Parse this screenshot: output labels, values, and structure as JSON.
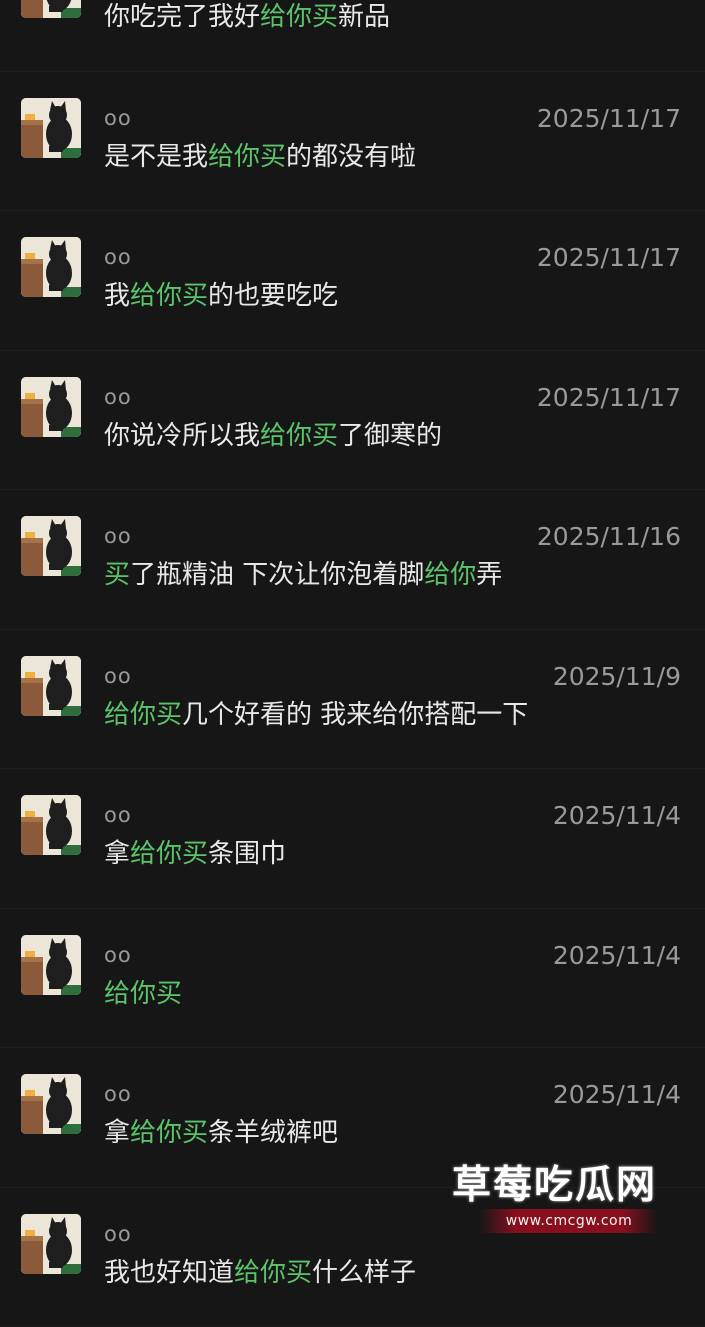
{
  "messages": [
    {
      "name": "",
      "date": "",
      "parts": [
        {
          "t": "你吃完了我好",
          "h": false
        },
        {
          "t": "给你买",
          "h": true
        },
        {
          "t": "新品",
          "h": false
        }
      ]
    },
    {
      "name": "oo",
      "date": "2025/11/17",
      "parts": [
        {
          "t": "是不是我",
          "h": false
        },
        {
          "t": "给你买",
          "h": true
        },
        {
          "t": "的都没有啦",
          "h": false
        }
      ]
    },
    {
      "name": "oo",
      "date": "2025/11/17",
      "parts": [
        {
          "t": "我",
          "h": false
        },
        {
          "t": "给你买",
          "h": true
        },
        {
          "t": "的也要吃吃",
          "h": false
        }
      ]
    },
    {
      "name": "oo",
      "date": "2025/11/17",
      "parts": [
        {
          "t": "你说冷所以我",
          "h": false
        },
        {
          "t": "给你买",
          "h": true
        },
        {
          "t": "了御寒的",
          "h": false
        }
      ]
    },
    {
      "name": "oo",
      "date": "2025/11/16",
      "parts": [
        {
          "t": "买",
          "h": true
        },
        {
          "t": "了瓶精油 下次让你泡着脚",
          "h": false
        },
        {
          "t": "给你",
          "h": true
        },
        {
          "t": "弄",
          "h": false
        }
      ]
    },
    {
      "name": "oo",
      "date": "2025/11/9",
      "parts": [
        {
          "t": "给你买",
          "h": true
        },
        {
          "t": "几个好看的 我来给你搭配一下",
          "h": false
        }
      ]
    },
    {
      "name": "oo",
      "date": "2025/11/4",
      "parts": [
        {
          "t": "拿",
          "h": false
        },
        {
          "t": "给你买",
          "h": true
        },
        {
          "t": "条围巾",
          "h": false
        }
      ]
    },
    {
      "name": "oo",
      "date": "2025/11/4",
      "parts": [
        {
          "t": "给你买",
          "h": true
        }
      ]
    },
    {
      "name": "oo",
      "date": "2025/11/4",
      "parts": [
        {
          "t": "拿",
          "h": false
        },
        {
          "t": "给你买",
          "h": true
        },
        {
          "t": "条羊绒裤吧",
          "h": false
        }
      ]
    },
    {
      "name": "oo",
      "date": "",
      "parts": [
        {
          "t": "我也好知道",
          "h": false
        },
        {
          "t": "给你买",
          "h": true
        },
        {
          "t": "什么样子",
          "h": false
        }
      ]
    }
  ],
  "watermark": {
    "title": "草莓吃瓜网",
    "url": "www.cmcgw.com"
  },
  "colors": {
    "background": "#161616",
    "highlight": "#5bc46a",
    "meta": "#9a9a9a",
    "text": "#e8e8e8"
  },
  "icons": {
    "avatar": "black-cat-avatar-icon"
  }
}
